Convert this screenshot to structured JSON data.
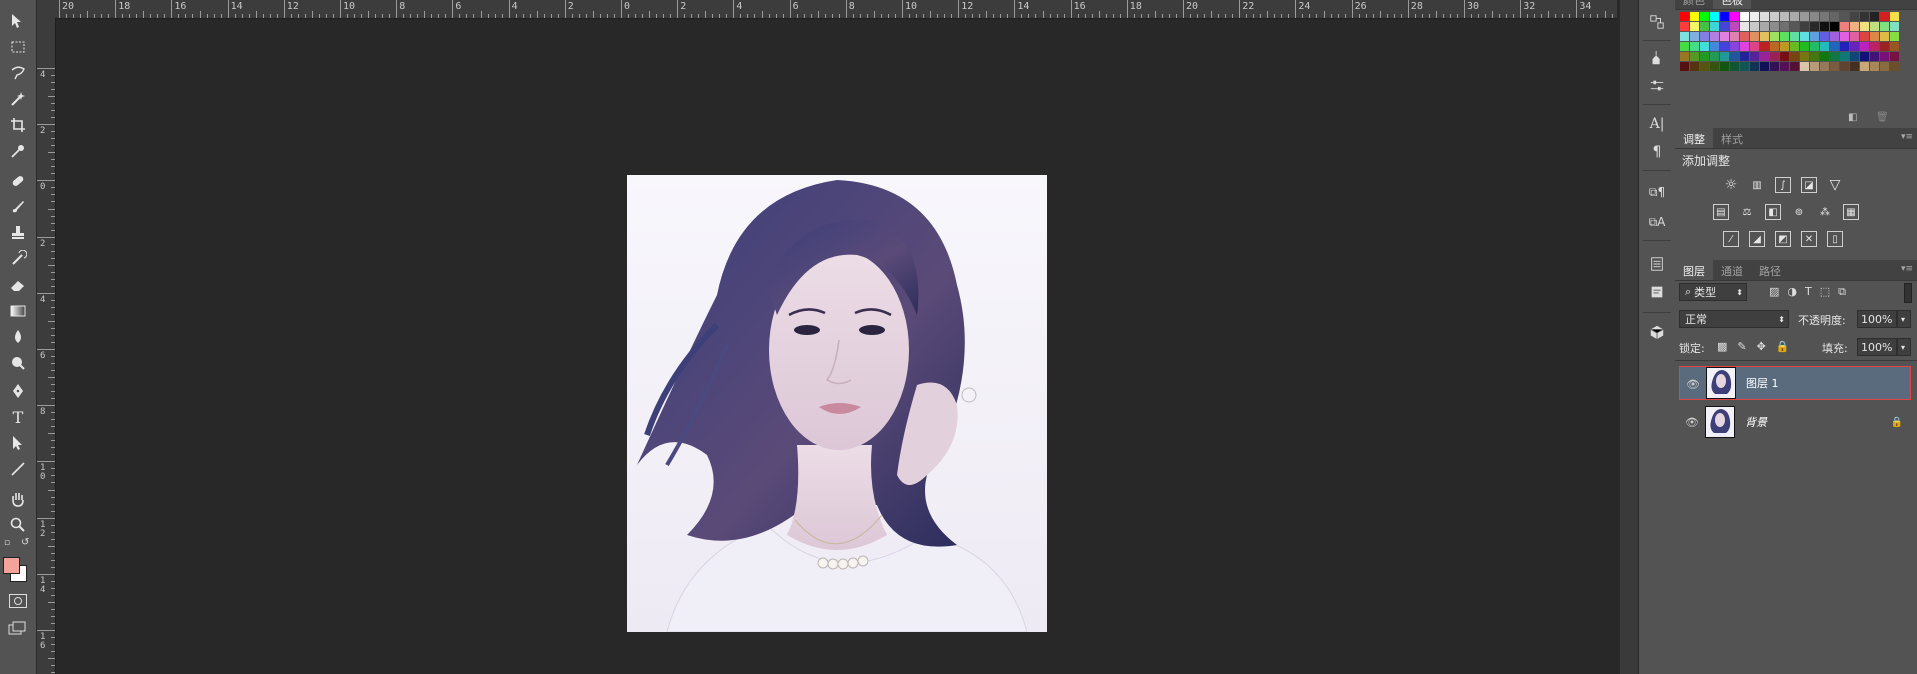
{
  "toolbar": {
    "tools": [
      "move-tool",
      "marquee-tool",
      "lasso-tool",
      "magic-wand-tool",
      "crop-tool",
      "eyedropper-tool",
      "healing-brush-tool",
      "brush-tool",
      "clone-stamp-tool",
      "history-brush-tool",
      "eraser-tool",
      "gradient-tool",
      "blur-tool",
      "dodge-tool",
      "pen-tool",
      "type-tool",
      "path-selection-tool",
      "line-tool",
      "hand-tool",
      "zoom-tool"
    ],
    "foreground_color": "#f2a49a",
    "background_color": "#ffffff"
  },
  "ruler_top": [
    "20",
    "18",
    "16",
    "14",
    "12",
    "10",
    "8",
    "6",
    "4",
    "2",
    "0",
    "2",
    "4",
    "6",
    "8",
    "10",
    "12",
    "14",
    "16",
    "18",
    "20",
    "22",
    "24",
    "26",
    "28",
    "30",
    "32",
    "34"
  ],
  "ruler_left": [
    "4",
    "2",
    "0",
    "2",
    "4",
    "6",
    "8",
    "10",
    "12",
    "14",
    "16"
  ],
  "panels": {
    "color": {
      "tabs": [
        "颜色",
        "色板"
      ],
      "active": "色板"
    },
    "adjustments": {
      "tabs": [
        "调整",
        "样式"
      ],
      "title": "添加调整"
    },
    "layers": {
      "tabs": [
        "图层",
        "通道",
        "路径"
      ],
      "filter_label": "类型",
      "blend_mode": "正常",
      "opacity_label": "不透明度:",
      "opacity_value": "100%",
      "lock_label": "锁定:",
      "fill_label": "填充:",
      "fill_value": "100%",
      "items": [
        {
          "name": "图层 1",
          "selected": true
        },
        {
          "name": "背景",
          "selected": false,
          "locked": true
        }
      ]
    }
  },
  "colors": {
    "accent": "#e04444",
    "panel": "#535353",
    "selected_layer": "#5a6b7e"
  }
}
